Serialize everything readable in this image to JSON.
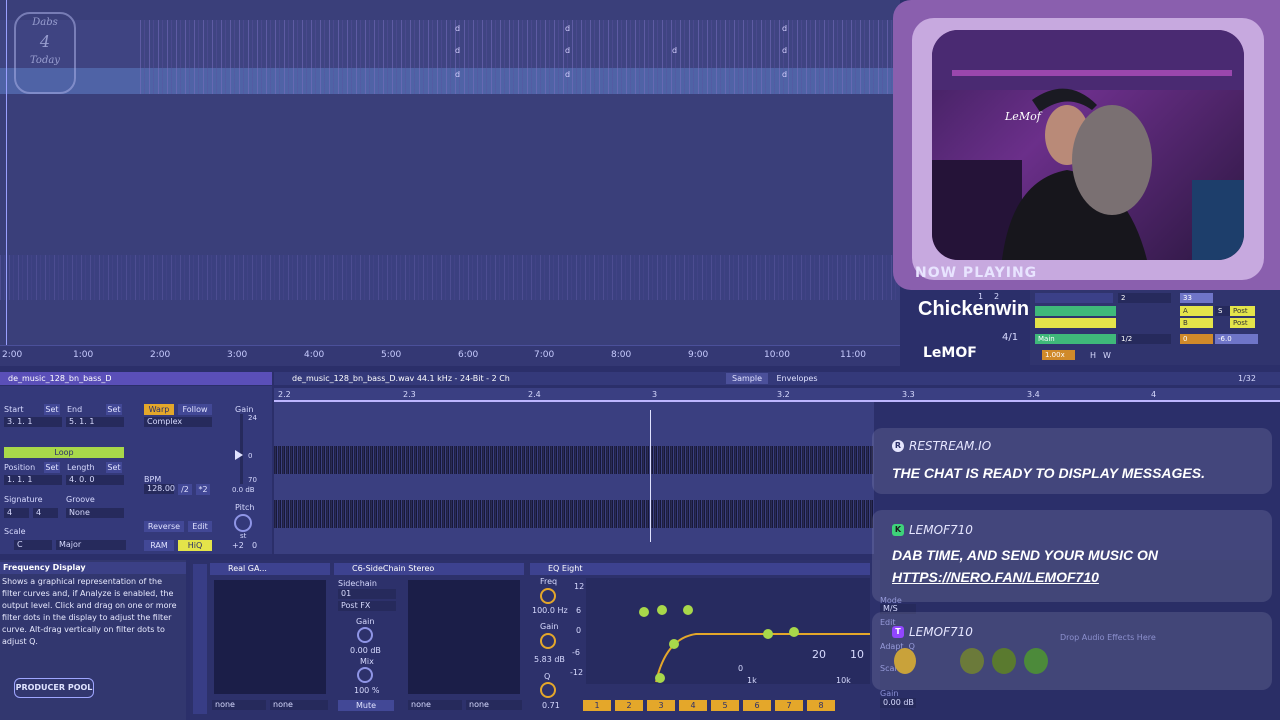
{
  "arrangement": {
    "logo": {
      "line1": "Dabs",
      "line2": "4",
      "line3": "Today"
    },
    "clip_marks": [
      "d",
      "d",
      "d",
      "d",
      "d",
      "d",
      "d",
      "d",
      "d",
      "d"
    ],
    "ruler_ticks": [
      "2:00",
      "1:00",
      "2:00",
      "3:00",
      "4:00",
      "5:00",
      "6:00",
      "7:00",
      "8:00",
      "9:00",
      "10:00",
      "11:00"
    ]
  },
  "webcam": {
    "now_playing_label": "NOW PLAYING",
    "track": "Chickenwingyy",
    "artist": "LeMOF",
    "neon_sign": "LeMof"
  },
  "mixer": {
    "track_num": "2",
    "io_values": [
      "1",
      "2",
      "4/1",
      "33",
      "A",
      "B",
      "S",
      "Post",
      "Post"
    ],
    "input_label": "Main",
    "routing": "1/2",
    "vol": "0",
    "pan": "-6.0",
    "tempo_small": "1.00x",
    "h": "H",
    "w": "W"
  },
  "clip": {
    "name": "de_music_128_bn_bass_D",
    "start_label": "Start",
    "end_label": "End",
    "set": "Set",
    "start_val": "3.   1.   1",
    "end_val": "5.   1.   1",
    "loop": "Loop",
    "position_label": "Position",
    "length_label": "Length",
    "position_val": "1.   1.   1",
    "length_val": "4.   0.   0",
    "signature_label": "Signature",
    "groove_label": "Groove",
    "sig_num": "4",
    "sig_den": "4",
    "groove_val": "None",
    "scale_label": "Scale",
    "scale_root": "C",
    "scale_mode": "Major",
    "warp": "Warp",
    "follow": "Follow",
    "warp_mode": "Complex",
    "bpm_label": "BPM",
    "bpm_val": "128.00",
    "half": "/2",
    "double": "*2",
    "reverse": "Reverse",
    "edit": "Edit",
    "ram": "RAM",
    "hiq": "HiQ",
    "gain_label": "Gain",
    "gain_top": "24",
    "gain_zero": "0",
    "gain_bottom": "70",
    "gain_db": "0.0 dB",
    "pitch_label": "Pitch",
    "pitch_unit": "st",
    "pitch_val": "+2",
    "pitch_fine": "0"
  },
  "sample": {
    "file": "de_music_128_bn_bass_D.wav  44.1 kHz - 24-Bit - 2 Ch",
    "tab_sample": "Sample",
    "tab_envelopes": "Envelopes",
    "quant": "1/32",
    "ruler": [
      "2.2",
      "2.3",
      "2.4",
      "3",
      "3.2",
      "3.3",
      "3.4",
      "4"
    ]
  },
  "help": {
    "title": "Frequency Display",
    "body": "Shows a graphical representation of the filter curves and, if Analyze is enabled, the output level. Click and drag on one or more filter dots in the display to adjust the filter curve. Alt-drag vertically on filter dots to adjust Q.",
    "producer_pool": "PRODUCER POOL"
  },
  "devices": {
    "dev1": {
      "title": "Real GA...",
      "none1": "none",
      "none2": "none"
    },
    "dev2": {
      "title": "C6-SideChain Stereo",
      "sidechain": "Sidechain",
      "sc_val": "01",
      "post_fx": "Post FX",
      "gain": "Gain",
      "gain_val": "0.00 dB",
      "mix": "Mix",
      "mix_val": "100 %",
      "none1": "none",
      "mute": "Mute"
    },
    "dev3": {
      "none1": "none",
      "none2": "none"
    },
    "eq": {
      "title": "EQ Eight",
      "freq": "Freq",
      "freq_val": "100.0 Hz",
      "gain": "Gain",
      "gain_val": "5.83 dB",
      "q": "Q",
      "q_val": "0.71",
      "scale": [
        "12",
        "6",
        "0",
        "-6",
        "-12"
      ],
      "bands": [
        "1",
        "2",
        "3",
        "4",
        "5",
        "6",
        "7",
        "8"
      ],
      "axis": [
        "1k",
        "10k",
        "10",
        "20",
        "0"
      ]
    },
    "drop_text": "Drop Audio Effects Here",
    "mode": "Mode",
    "ms": "M/S",
    "edit": "Edit",
    "adapt": "Adapt. Q",
    "scale": "Scale",
    "gain": "Gain",
    "gain_val": "0.00 dB"
  },
  "chat": {
    "m1": {
      "user": "RESTREAM.IO",
      "text": "THE CHAT IS READY TO DISPLAY MESSAGES."
    },
    "m2": {
      "user": "LEMOF710",
      "text1": "DAB TIME, AND SEND YOUR MUSIC ON",
      "text2": "HTTPS://NERO.FAN/LEMOF710"
    },
    "m3": {
      "user": "LEMOF710"
    }
  },
  "colors": {
    "accent_purple": "#5a4fb8",
    "chat_green": "#3ed37a",
    "chat_purple": "#9146ff",
    "mixer_yellow": "#e4e44a",
    "mixer_green": "#3fb97a"
  }
}
